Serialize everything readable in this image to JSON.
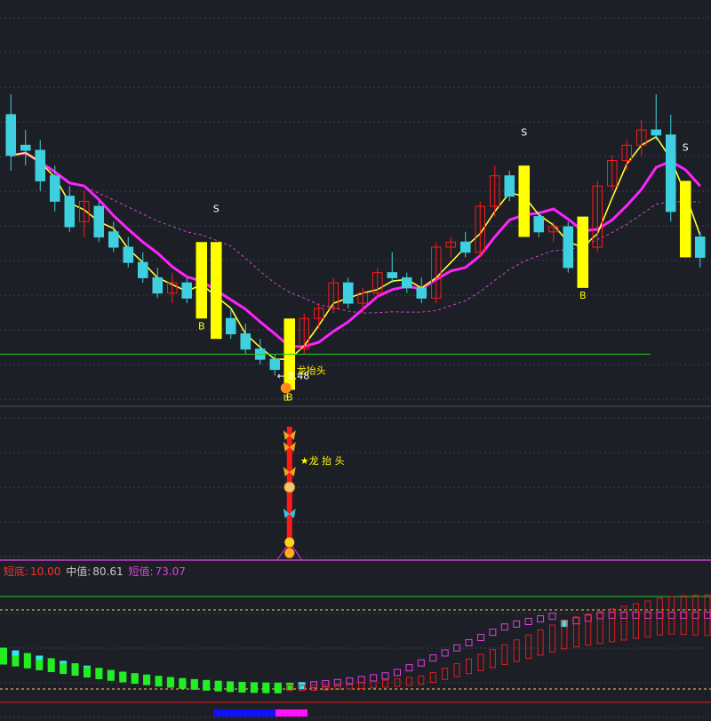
{
  "colors": {
    "background": "#1c1f26",
    "grid": "#3a3f4b",
    "up": "#ff1a1a",
    "down": "#3fd0e0",
    "ma_fast": "#ffff33",
    "ma_slow": "#ff22ff",
    "ma_long": "#d04ad0",
    "signal": "#ffff00",
    "support": "#22cc22",
    "osc_green": "#22ee22",
    "osc_cyan": "#33e6f0",
    "osc_magenta": "#e040e0",
    "osc_red": "#e01f1f",
    "osc_yellow_dash": "#ffd24a",
    "bottom_blue": "#1010ff",
    "bottom_magenta": "#ff10ff",
    "readout_red": "#ff3030",
    "readout_gray": "#c8c8c8",
    "readout_magenta": "#e040e0"
  },
  "icons": [
    "butterfly-icon",
    "money-bag-icon",
    "gold-coin-icon"
  ],
  "main_panel": {
    "signals": [
      {
        "label": "S",
        "i": 14
      },
      {
        "label": "B",
        "i": 13
      },
      {
        "label": "B",
        "i": 19
      },
      {
        "label": "S",
        "i": 35
      },
      {
        "label": "B",
        "i": 39
      },
      {
        "label": "S",
        "i": 46
      }
    ],
    "low_marker": "8.48",
    "annotation": "龙抬头",
    "annotation_prefix": "←",
    "b_glyph": "B"
  },
  "sub_panel": {
    "annotation": "★龙 抬 头"
  },
  "readout": {
    "short_bottom_label": "短底:",
    "short_bottom_value": "10.00",
    "mid_label": "中值:",
    "mid_value": "80.61",
    "short_label": "短值:",
    "short_value": "73.07"
  },
  "chart_data": {
    "type": "candlestick",
    "candles": [
      [
        13.6,
        14.0,
        12.5,
        12.8
      ],
      [
        13.0,
        13.3,
        12.6,
        12.9
      ],
      [
        12.9,
        13.1,
        12.1,
        12.3
      ],
      [
        12.4,
        12.6,
        11.7,
        11.9
      ],
      [
        12.0,
        12.2,
        11.3,
        11.4
      ],
      [
        11.5,
        12.1,
        11.2,
        11.9
      ],
      [
        11.8,
        11.9,
        11.1,
        11.2
      ],
      [
        11.3,
        11.5,
        10.9,
        11.0
      ],
      [
        11.0,
        11.2,
        10.6,
        10.7
      ],
      [
        10.7,
        10.9,
        10.3,
        10.4
      ],
      [
        10.4,
        10.6,
        10.0,
        10.1
      ],
      [
        10.1,
        10.5,
        9.9,
        10.3
      ],
      [
        10.3,
        10.4,
        9.9,
        10.0
      ],
      [
        10.0,
        10.6,
        9.9,
        10.5
      ],
      [
        10.5,
        10.9,
        9.5,
        9.6
      ],
      [
        9.6,
        9.8,
        9.2,
        9.3
      ],
      [
        9.3,
        9.5,
        8.9,
        9.0
      ],
      [
        9.0,
        9.2,
        8.7,
        8.8
      ],
      [
        8.8,
        8.9,
        8.48,
        8.6
      ],
      [
        8.6,
        9.1,
        8.5,
        9.0
      ],
      [
        9.0,
        9.7,
        8.9,
        9.6
      ],
      [
        9.6,
        9.9,
        9.4,
        9.8
      ],
      [
        9.8,
        10.4,
        9.7,
        10.3
      ],
      [
        10.3,
        10.4,
        9.8,
        9.9
      ],
      [
        9.9,
        10.2,
        9.7,
        10.1
      ],
      [
        10.1,
        10.6,
        10.0,
        10.5
      ],
      [
        10.5,
        10.9,
        10.3,
        10.4
      ],
      [
        10.4,
        10.5,
        10.1,
        10.2
      ],
      [
        10.2,
        10.4,
        9.9,
        10.0
      ],
      [
        10.0,
        11.1,
        9.9,
        11.0
      ],
      [
        11.0,
        11.2,
        10.8,
        11.1
      ],
      [
        11.1,
        11.3,
        10.8,
        10.9
      ],
      [
        10.9,
        11.9,
        10.8,
        11.8
      ],
      [
        11.8,
        12.6,
        11.6,
        12.4
      ],
      [
        12.4,
        12.5,
        11.9,
        12.0
      ],
      [
        12.0,
        12.1,
        11.5,
        11.6
      ],
      [
        11.6,
        11.7,
        11.2,
        11.3
      ],
      [
        11.3,
        11.5,
        11.1,
        11.4
      ],
      [
        11.4,
        11.5,
        10.5,
        10.6
      ],
      [
        10.6,
        11.1,
        10.4,
        11.0
      ],
      [
        11.0,
        12.3,
        10.9,
        12.2
      ],
      [
        12.2,
        12.8,
        12.1,
        12.7
      ],
      [
        12.7,
        13.1,
        12.5,
        13.0
      ],
      [
        13.0,
        13.5,
        12.8,
        13.3
      ],
      [
        13.3,
        14.0,
        13.1,
        13.2
      ],
      [
        13.2,
        13.6,
        11.5,
        11.7
      ],
      [
        11.7,
        12.0,
        11.0,
        11.2
      ],
      [
        11.2,
        11.3,
        10.6,
        10.8
      ]
    ],
    "support_line": 8.9,
    "low_value": 8.48,
    "ylim": [
      8.0,
      15.5
    ]
  }
}
